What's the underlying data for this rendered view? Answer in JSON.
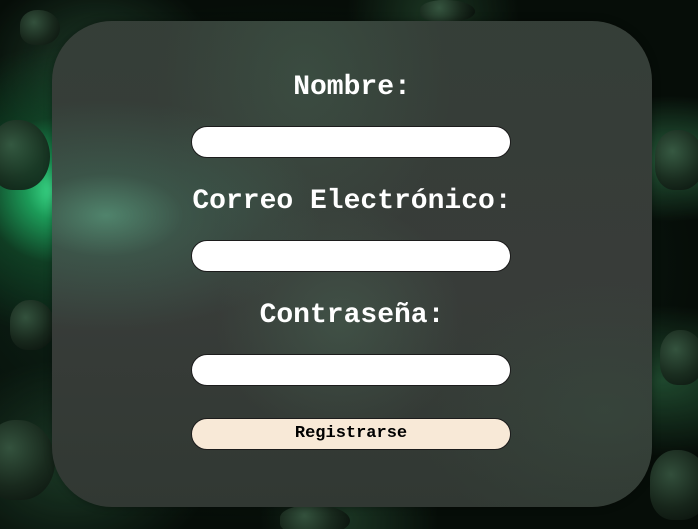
{
  "form": {
    "name_label": "Nombre:",
    "name_value": "",
    "email_label": "Correo Electrónico:",
    "email_value": "",
    "password_label": "Contraseña:",
    "password_value": "",
    "submit_label": "Registrarse"
  },
  "colors": {
    "card_background": "#3a3c3a",
    "label_text": "#ffffff",
    "input_background": "#ffffff",
    "button_background": "#f8e9d7",
    "glow_accent": "#3fe28f"
  }
}
